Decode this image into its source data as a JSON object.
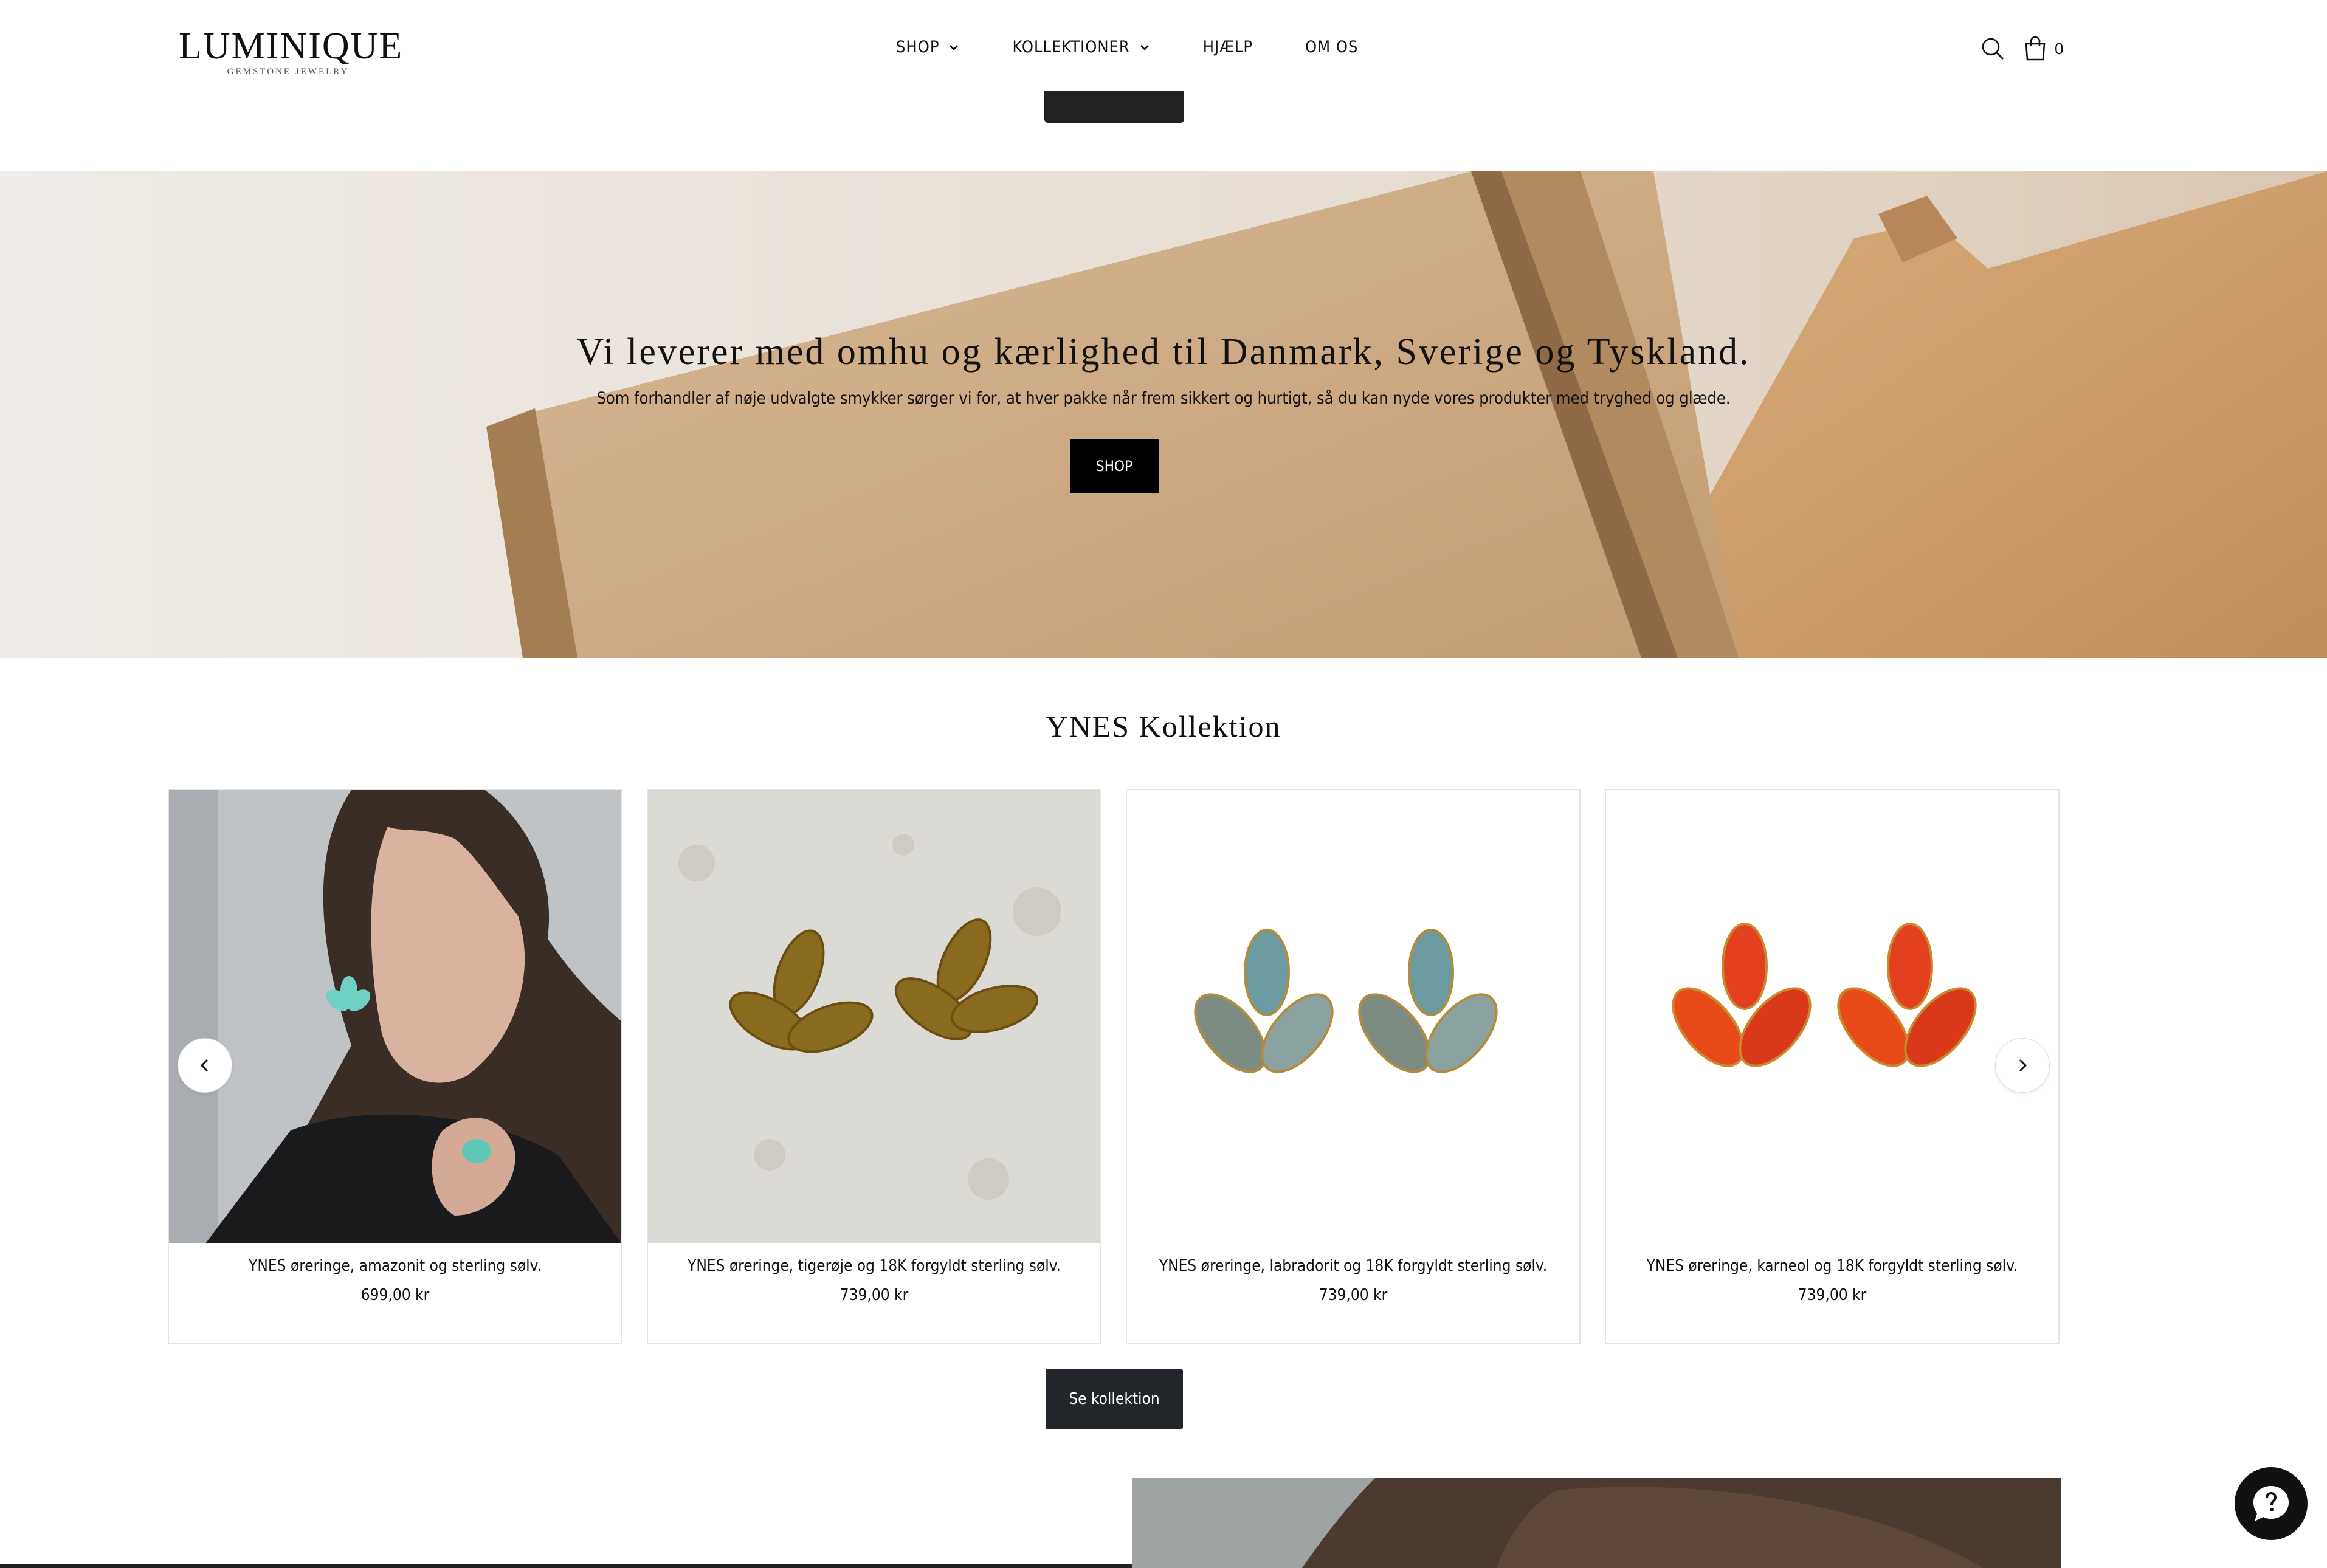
{
  "header": {
    "logo": "LUMINIQUE",
    "logo_sub": "GEMSTONE JEWELRY",
    "nav": [
      {
        "label": "SHOP"
      },
      {
        "label": "KOLLEKTIONER"
      },
      {
        "label": "HJÆLP"
      },
      {
        "label": "OM OS"
      }
    ],
    "cart_count": "0",
    "icons": [
      "search-icon",
      "cart-icon",
      "chevron-down-icon"
    ]
  },
  "hero": {
    "title": "Vi leverer med omhu og kærlighed til Danmark, Sverige og Tyskland.",
    "subtitle": "Som forhandler af nøje udvalgte smykker sørger vi for, at hver pakke når frem sikkert og hurtigt, så du kan nyde vores produkter med tryghed og glæde.",
    "button": "SHOP"
  },
  "collection": {
    "title": "YNES Kollektion",
    "products": [
      {
        "name": "YNES øreringe, amazonit og sterling sølv.",
        "price": "699,00 kr"
      },
      {
        "name": "YNES øreringe, tigerøje og 18K forgyldt sterling sølv.",
        "price": "739,00 kr"
      },
      {
        "name": "YNES øreringe, labradorit og 18K forgyldt sterling sølv.",
        "price": "739,00 kr"
      },
      {
        "name": "YNES øreringe, karneol og 18K forgyldt sterling sølv.",
        "price": "739,00 kr"
      }
    ],
    "button": "Se kollektion"
  },
  "colors": {
    "accent": "#111111",
    "button_dark": "#22262a",
    "kraft": "#c9a27a"
  }
}
